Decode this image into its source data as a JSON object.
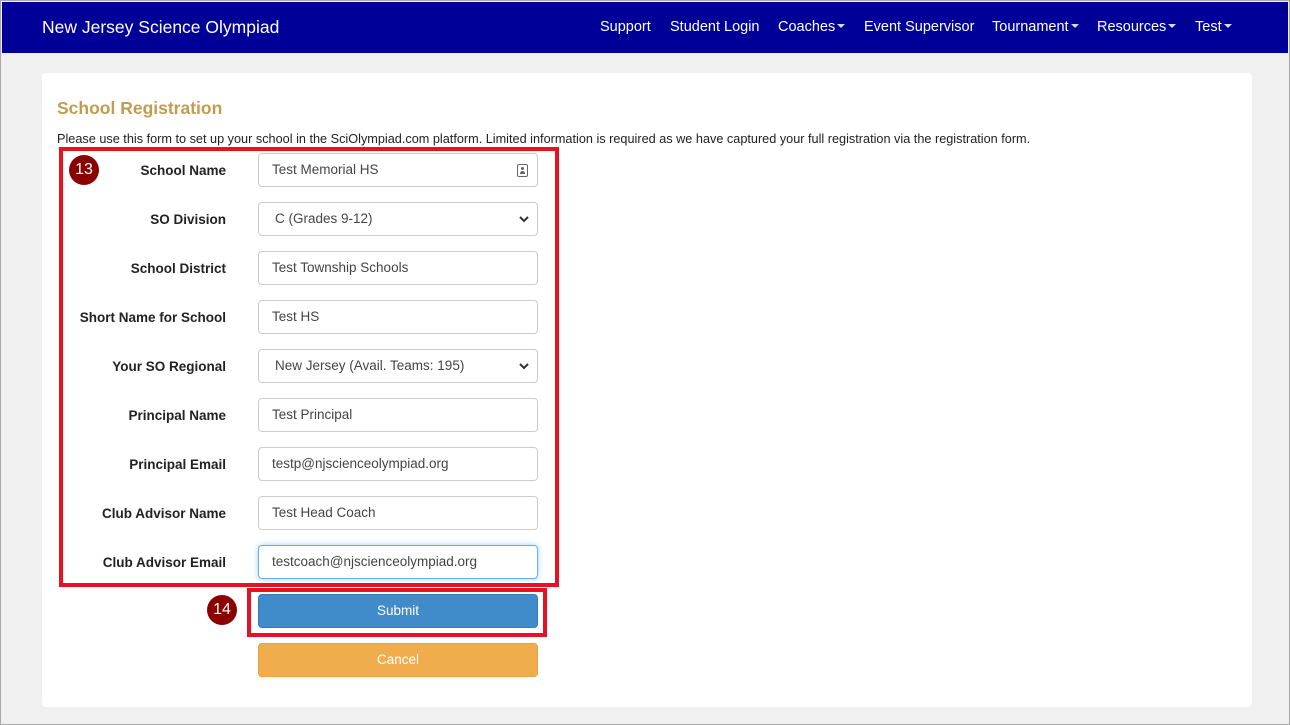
{
  "navbar": {
    "brand": "New Jersey Science Olympiad",
    "items": [
      {
        "label": "Support",
        "dropdown": false
      },
      {
        "label": "Student Login",
        "dropdown": false
      },
      {
        "label": "Coaches",
        "dropdown": true
      },
      {
        "label": "Event Supervisor",
        "dropdown": false
      },
      {
        "label": "Tournament",
        "dropdown": true
      },
      {
        "label": "Resources",
        "dropdown": true
      },
      {
        "label": "Test",
        "dropdown": true
      }
    ]
  },
  "page": {
    "title": "School Registration",
    "intro": "Please use this form to set up your school in the SciOlympiad.com platform.  Limited information is required as we have captured your full registration via the registration form."
  },
  "form": {
    "school_name": {
      "label": "School Name",
      "value": "Test Memorial HS"
    },
    "so_division": {
      "label": "SO Division",
      "value": "C (Grades 9-12)"
    },
    "school_district": {
      "label": "School District",
      "value": "Test Township Schools"
    },
    "short_name": {
      "label": "Short Name for School",
      "value": "Test HS"
    },
    "so_regional": {
      "label": "Your SO Regional",
      "value": "New Jersey (Avail. Teams: 195)"
    },
    "principal_name": {
      "label": "Principal Name",
      "value": "Test Principal"
    },
    "principal_email": {
      "label": "Principal Email",
      "value": "testp@njscienceolympiad.org"
    },
    "advisor_name": {
      "label": "Club Advisor Name",
      "value": "Test Head Coach"
    },
    "advisor_email": {
      "label": "Club Advisor Email",
      "value": "testcoach@njscienceolympiad.org"
    },
    "submit_label": "Submit",
    "cancel_label": "Cancel"
  },
  "annotations": {
    "step_form": "13",
    "step_submit": "14",
    "highlight_color": "#e81123",
    "badge_color": "#8b0000"
  },
  "colors": {
    "navbar": "#000099",
    "title": "#c39b51",
    "submit": "#428bca",
    "cancel": "#f0ad4e"
  }
}
